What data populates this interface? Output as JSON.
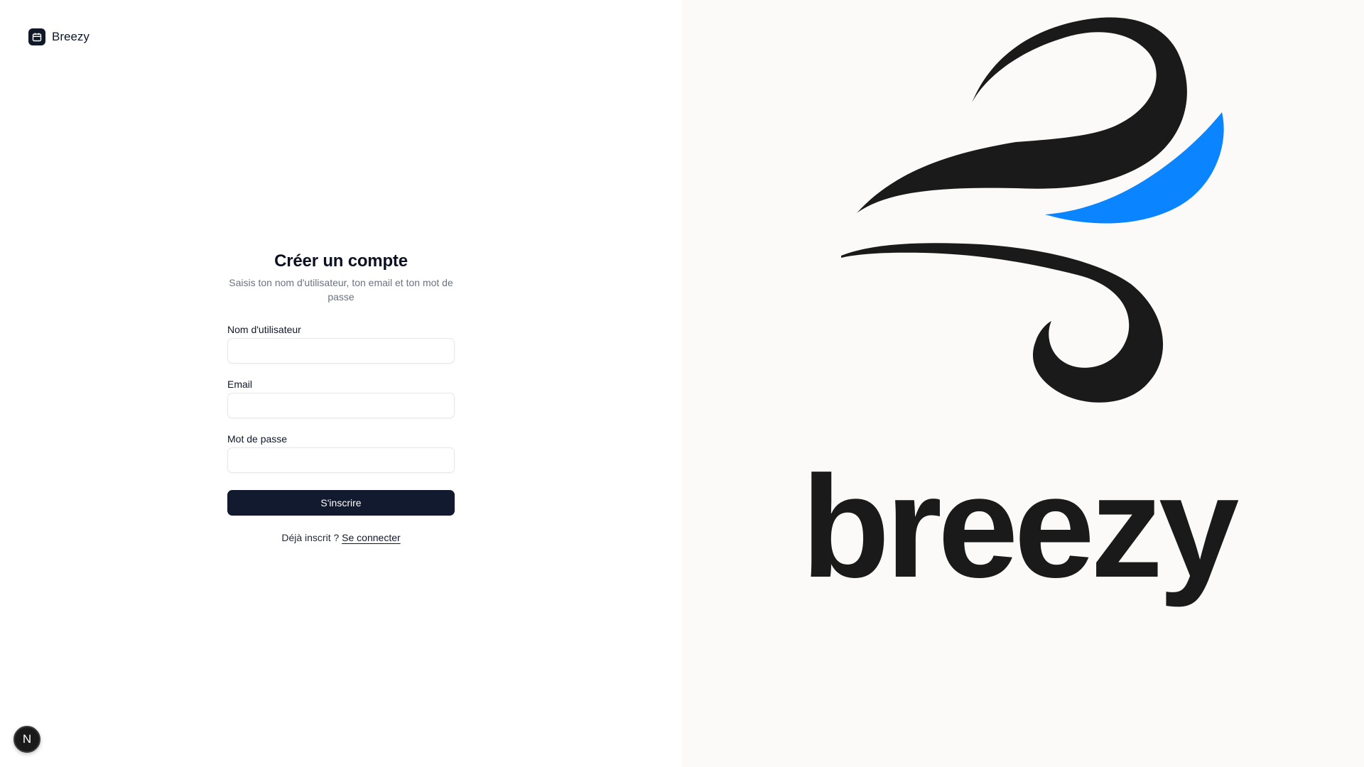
{
  "brand": {
    "name": "Breezy",
    "icon": "calendar-icon"
  },
  "form": {
    "title": "Créer un compte",
    "subtitle": "Saisis ton nom d'utilisateur, ton email et ton mot de passe",
    "fields": [
      {
        "label": "Nom d'utilisateur",
        "value": "",
        "placeholder": ""
      },
      {
        "label": "Email",
        "value": "",
        "placeholder": ""
      },
      {
        "label": "Mot de passe",
        "value": "",
        "placeholder": ""
      }
    ],
    "submit_label": "S'inscrire",
    "login_prompt": "Déjà inscrit ?",
    "login_link": "Se connecter"
  },
  "hero": {
    "wordmark": "breezy",
    "icon": "wind-logo-icon",
    "accent_color": "#0a84ff",
    "ink_color": "#1a1a1a"
  },
  "dev_badge": {
    "text": "N"
  },
  "colors": {
    "primary_button": "#111a2e",
    "right_panel_bg": "#fbfaf8"
  }
}
